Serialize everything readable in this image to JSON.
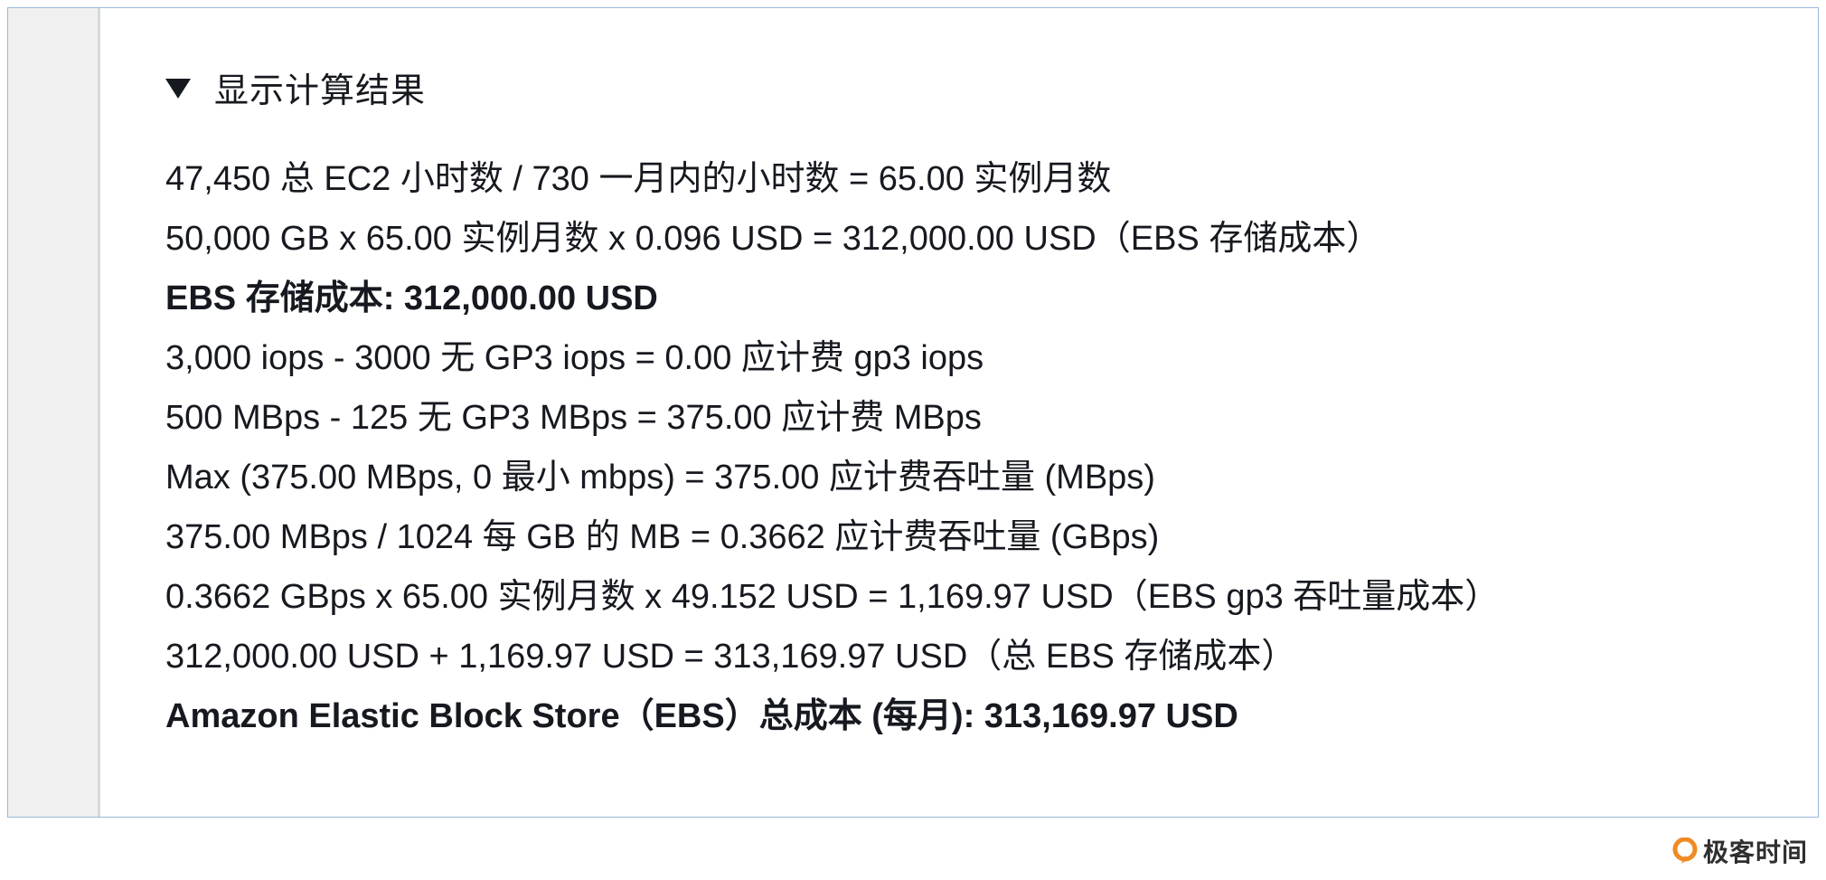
{
  "section": {
    "toggle_label": "显示计算结果",
    "expanded": true
  },
  "calculation_lines": [
    {
      "text": "47,450 总 EC2 小时数 / 730 一月内的小时数 = 65.00 实例月数",
      "bold": false
    },
    {
      "text": "50,000 GB x 65.00 实例月数 x 0.096 USD = 312,000.00 USD（EBS 存储成本）",
      "bold": false
    },
    {
      "text": "EBS 存储成本: 312,000.00 USD",
      "bold": true
    },
    {
      "text": "3,000 iops - 3000 无 GP3 iops = 0.00 应计费 gp3 iops",
      "bold": false
    },
    {
      "text": "500 MBps - 125 无 GP3 MBps = 375.00 应计费 MBps",
      "bold": false
    },
    {
      "text": "Max (375.00 MBps, 0 最小 mbps) = 375.00 应计费吞吐量 (MBps)",
      "bold": false
    },
    {
      "text": "375.00 MBps / 1024 每 GB 的 MB = 0.3662 应计费吞吐量 (GBps)",
      "bold": false
    },
    {
      "text": "0.3662 GBps x 65.00 实例月数 x 49.152 USD = 1,169.97 USD（EBS gp3 吞吐量成本）",
      "bold": false
    },
    {
      "text": "312,000.00 USD + 1,169.97 USD = 313,169.97 USD（总 EBS 存储成本）",
      "bold": false
    },
    {
      "text": "Amazon Elastic Block Store（EBS）总成本 (每月): 313,169.97 USD",
      "bold": true
    }
  ],
  "watermark": {
    "text": "极客时间",
    "icon": "geektime-logo-icon",
    "color": "#f08a24"
  }
}
